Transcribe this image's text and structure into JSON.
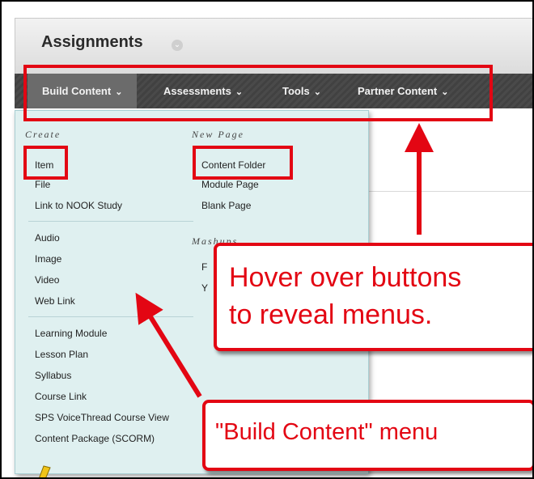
{
  "page": {
    "title": "Assignments"
  },
  "nav": {
    "build_content": "Build Content",
    "assessments": "Assessments",
    "tools": "Tools",
    "partner_content": "Partner Content"
  },
  "menu": {
    "create_heading": "Create",
    "new_page_heading": "New Page",
    "mashups_heading": "Mashups",
    "create": [
      "Item",
      "File",
      "Link to NOOK Study"
    ],
    "media": [
      "Audio",
      "Image",
      "Video",
      "Web Link"
    ],
    "learning": [
      "Learning Module",
      "Lesson Plan",
      "Syllabus",
      "Course Link",
      "SPS VoiceThread Course View",
      "Content Package (SCORM)"
    ],
    "new_page": [
      "Content Folder",
      "Module Page",
      "Blank Page"
    ],
    "mashups_partial": [
      "F",
      "Y"
    ]
  },
  "annotations": {
    "hover_line1": "Hover over buttons",
    "hover_line2": "to reveal menus.",
    "menu_label": "\"Build Content\" menu",
    "color": "#e30613"
  },
  "icons": {
    "title_chevron": "chevron-down-icon",
    "nav_caret": "chevron-down-icon"
  }
}
